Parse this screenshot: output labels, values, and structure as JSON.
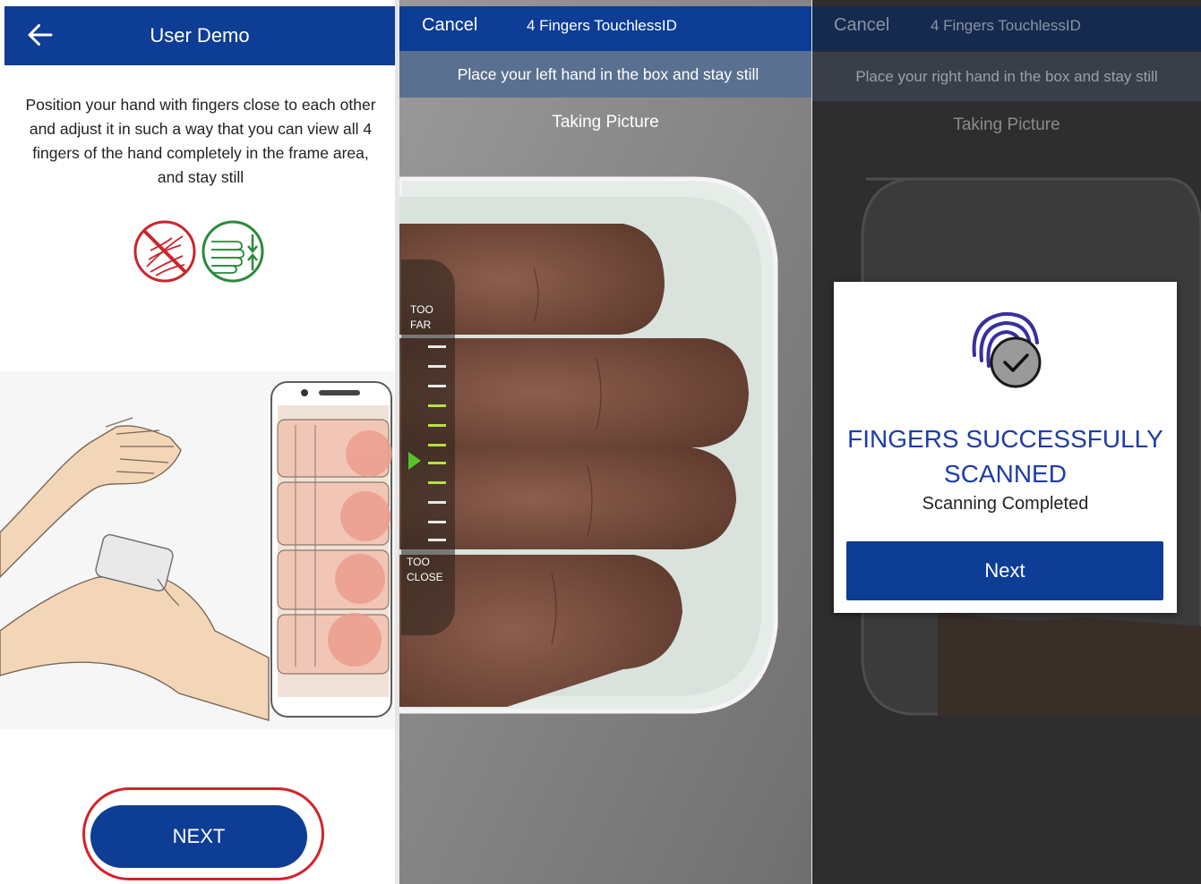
{
  "panel1": {
    "header": {
      "title": "User Demo",
      "back_icon": "arrow-left-icon"
    },
    "instruction": "Position your hand with fingers close to each other and adjust it in such a way that you can view all 4 fingers of the hand completely in the frame area, and stay still",
    "icons": [
      "spread-fingers-prohibited-icon",
      "fingers-together-allowed-icon"
    ],
    "next_label": "NEXT",
    "colors": {
      "header": "#0d3d94",
      "highlight": "#d2232a",
      "wrong": "#c9262c",
      "right": "#2a8a3a"
    }
  },
  "panel2": {
    "header": {
      "cancel_label": "Cancel",
      "title": "4 Fingers TouchlessID"
    },
    "banner": "Place your left hand in the box and stay still",
    "status": "Taking Picture",
    "gauge": {
      "top_label_1": "TOO",
      "top_label_2": "FAR",
      "bottom_label_1": "TOO",
      "bottom_label_2": "CLOSE"
    }
  },
  "panel3": {
    "header": {
      "cancel_label": "Cancel",
      "title": "4 Fingers TouchlessID"
    },
    "banner": "Place your right hand in the box and stay still",
    "status": "Taking Picture",
    "modal": {
      "icon": "fingerprint-check-icon",
      "title_line1": "FINGERS SUCCESSFULLY",
      "title_line2": "SCANNED",
      "subtitle": "Scanning Completed",
      "button_label": "Next"
    }
  }
}
